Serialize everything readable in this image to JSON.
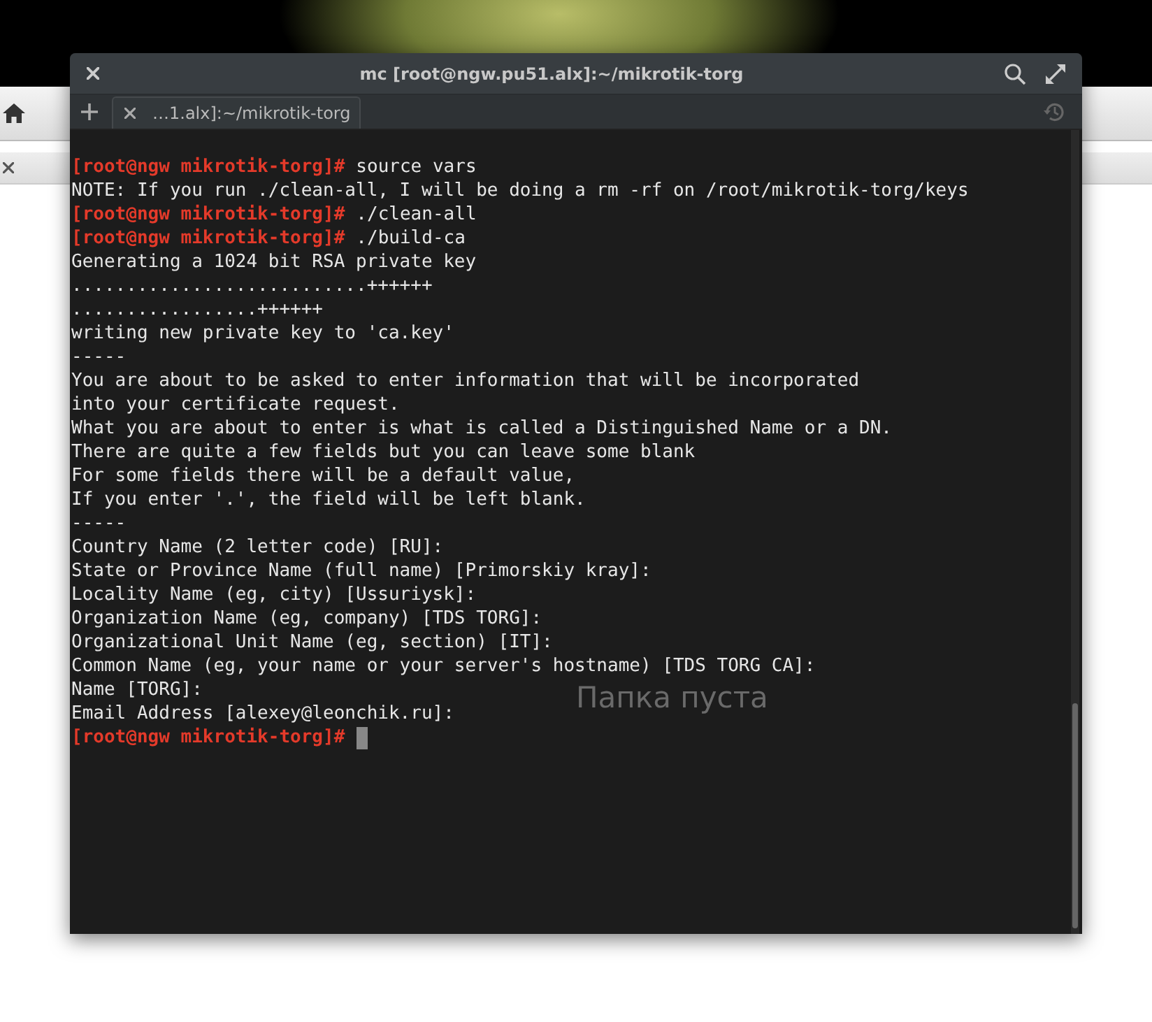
{
  "window": {
    "title": "mc [root@ngw.pu51.alx]:~/mikrotik-torg"
  },
  "tabs": [
    {
      "label": "…1.alx]:~/mikrotik-torg",
      "selected": true
    }
  ],
  "terminal": {
    "cursor_visible": true,
    "lines": [
      {
        "kind": "prompt",
        "prompt": "[root@ngw mikrotik-torg]#",
        "command": "source vars"
      },
      {
        "kind": "output",
        "text": "NOTE: If you run ./clean-all, I will be doing a rm -rf on /root/mikrotik-torg/keys"
      },
      {
        "kind": "prompt",
        "prompt": "[root@ngw mikrotik-torg]#",
        "command": "./clean-all"
      },
      {
        "kind": "prompt",
        "prompt": "[root@ngw mikrotik-torg]#",
        "command": "./build-ca"
      },
      {
        "kind": "output",
        "text": "Generating a 1024 bit RSA private key"
      },
      {
        "kind": "output",
        "text": "...........................++++++"
      },
      {
        "kind": "output",
        "text": ".................++++++"
      },
      {
        "kind": "output",
        "text": "writing new private key to 'ca.key'"
      },
      {
        "kind": "output",
        "text": "-----"
      },
      {
        "kind": "output",
        "text": "You are about to be asked to enter information that will be incorporated"
      },
      {
        "kind": "output",
        "text": "into your certificate request."
      },
      {
        "kind": "output",
        "text": "What you are about to enter is what is called a Distinguished Name or a DN."
      },
      {
        "kind": "output",
        "text": "There are quite a few fields but you can leave some blank"
      },
      {
        "kind": "output",
        "text": "For some fields there will be a default value,"
      },
      {
        "kind": "output",
        "text": "If you enter '.', the field will be left blank."
      },
      {
        "kind": "output",
        "text": "-----"
      },
      {
        "kind": "output",
        "text": "Country Name (2 letter code) [RU]:"
      },
      {
        "kind": "output",
        "text": "State or Province Name (full name) [Primorskiy kray]:"
      },
      {
        "kind": "output",
        "text": "Locality Name (eg, city) [Ussuriysk]:"
      },
      {
        "kind": "output",
        "text": "Organization Name (eg, company) [TDS TORG]:"
      },
      {
        "kind": "output",
        "text": "Organizational Unit Name (eg, section) [IT]:"
      },
      {
        "kind": "output",
        "text": "Common Name (eg, your name or your server's hostname) [TDS TORG CA]:"
      },
      {
        "kind": "output",
        "text": "Name [TORG]:"
      },
      {
        "kind": "output",
        "text": "Email Address [alexey@leonchik.ru]:"
      },
      {
        "kind": "prompt",
        "prompt": "[root@ngw mikrotik-torg]#"
      }
    ]
  },
  "background_text": "Папка пуста"
}
